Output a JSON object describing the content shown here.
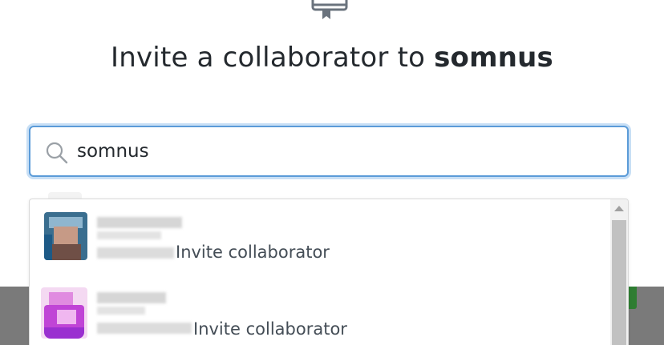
{
  "dialog": {
    "title_prefix": "Invite a collaborator to ",
    "repo_name": "somnus"
  },
  "search": {
    "value": "somnus",
    "placeholder": ""
  },
  "results": [
    {
      "action_label": "Invite collaborator"
    },
    {
      "action_label": "Invite collaborator"
    }
  ],
  "colors": {
    "focus_border": "#5b9bd8",
    "focus_ring": "#c8dff5",
    "text": "#24292e",
    "muted_text": "#444d56"
  },
  "icons": {
    "header": "repo-invite-icon",
    "search": "search-icon"
  }
}
